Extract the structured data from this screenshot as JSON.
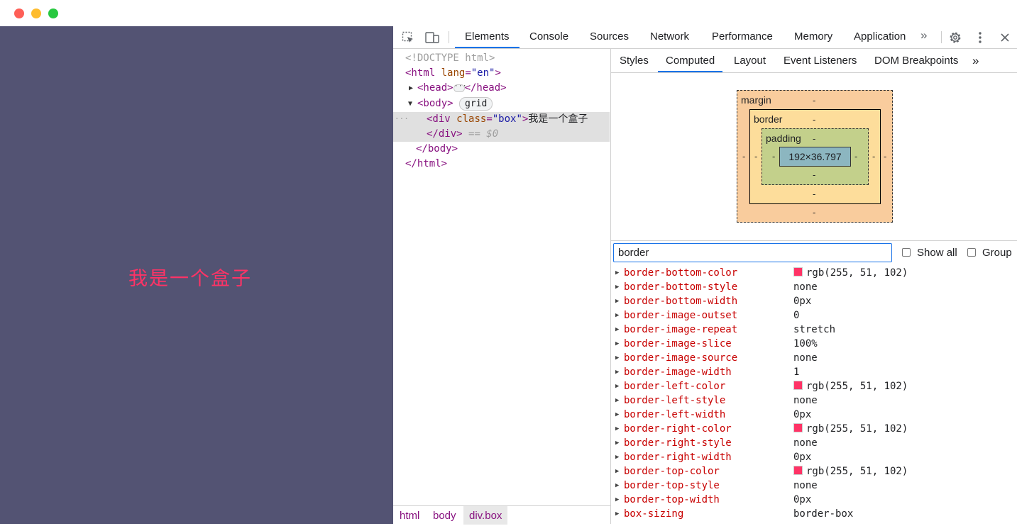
{
  "window": {
    "controls": [
      "close",
      "minimize",
      "maximize"
    ]
  },
  "page": {
    "box_text": "我是一个盒子",
    "text_color": "#ff3366",
    "bg_color": "#535373"
  },
  "devtools": {
    "tabs": [
      {
        "label": "Elements",
        "active": true
      },
      {
        "label": "Console"
      },
      {
        "label": "Sources"
      },
      {
        "label": "Network"
      },
      {
        "label": "Performance"
      },
      {
        "label": "Memory"
      },
      {
        "label": "Application"
      }
    ],
    "more_tabs": "»",
    "elements": {
      "doctype": "<!DOCTYPE html>",
      "html_open_tag": "<html",
      "html_attr": "lang",
      "html_attr_val": "\"en\"",
      "head_open": "<head>",
      "head_close": "</head>",
      "body_open": "<body>",
      "body_badge": "grid",
      "div_open": "<div",
      "div_attr": "class",
      "div_attr_val": "\"box\"",
      "div_text": "我是一个盒子",
      "div_close": "</div>",
      "selected_marker": "== $0",
      "body_close": "</body>",
      "html_close": "</html>",
      "row_dots": "···"
    },
    "breadcrumbs": [
      "html",
      "body",
      "div.box"
    ],
    "sidebar": {
      "tabs": [
        {
          "label": "Styles"
        },
        {
          "label": "Computed",
          "active": true
        },
        {
          "label": "Layout"
        },
        {
          "label": "Event Listeners"
        },
        {
          "label": "DOM Breakpoints"
        }
      ],
      "more": "»",
      "box_model": {
        "margin_label": "margin",
        "border_label": "border",
        "padding_label": "padding",
        "content": "192×36.797",
        "dash": "-"
      },
      "filter": {
        "value": "border",
        "show_all": "Show all",
        "group": "Group"
      },
      "properties": [
        {
          "name": "border-bottom-color",
          "value": "rgb(255, 51, 102)",
          "swatch": "#ff3366"
        },
        {
          "name": "border-bottom-style",
          "value": "none"
        },
        {
          "name": "border-bottom-width",
          "value": "0px"
        },
        {
          "name": "border-image-outset",
          "value": "0"
        },
        {
          "name": "border-image-repeat",
          "value": "stretch"
        },
        {
          "name": "border-image-slice",
          "value": "100%"
        },
        {
          "name": "border-image-source",
          "value": "none"
        },
        {
          "name": "border-image-width",
          "value": "1"
        },
        {
          "name": "border-left-color",
          "value": "rgb(255, 51, 102)",
          "swatch": "#ff3366"
        },
        {
          "name": "border-left-style",
          "value": "none"
        },
        {
          "name": "border-left-width",
          "value": "0px"
        },
        {
          "name": "border-right-color",
          "value": "rgb(255, 51, 102)",
          "swatch": "#ff3366"
        },
        {
          "name": "border-right-style",
          "value": "none"
        },
        {
          "name": "border-right-width",
          "value": "0px"
        },
        {
          "name": "border-top-color",
          "value": "rgb(255, 51, 102)",
          "swatch": "#ff3366"
        },
        {
          "name": "border-top-style",
          "value": "none"
        },
        {
          "name": "border-top-width",
          "value": "0px"
        },
        {
          "name": "box-sizing",
          "value": "border-box"
        }
      ]
    }
  }
}
